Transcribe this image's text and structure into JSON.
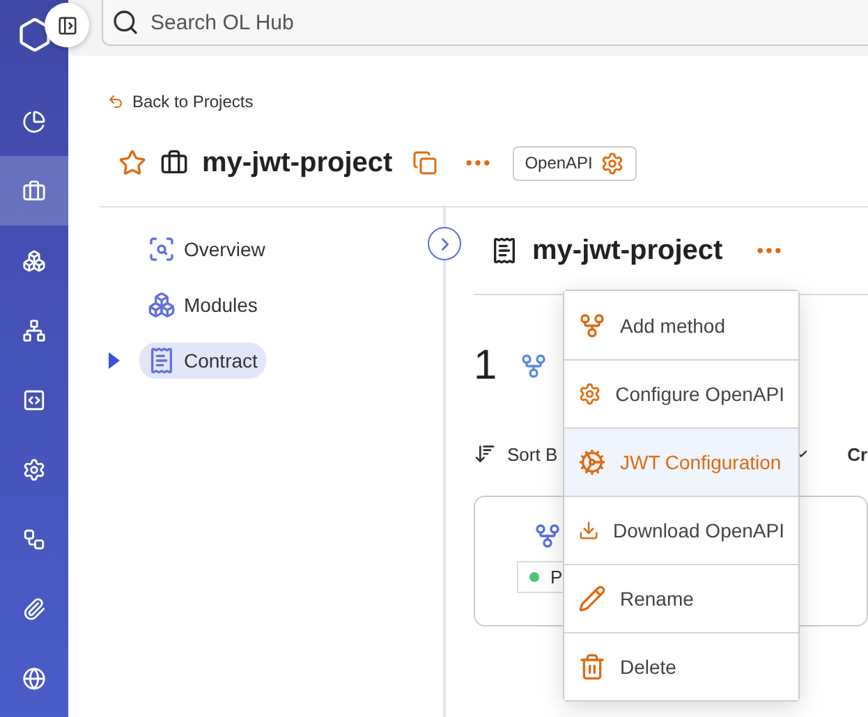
{
  "rail": {
    "items": [
      {
        "selected": false
      },
      {
        "selected": true
      },
      {
        "selected": false
      },
      {
        "selected": false
      },
      {
        "selected": false
      },
      {
        "selected": false
      },
      {
        "selected": false
      },
      {
        "selected": false
      },
      {
        "selected": false
      }
    ]
  },
  "search": {
    "placeholder": "Search OL Hub"
  },
  "back_link": "Back to Projects",
  "project": {
    "title": "my-jwt-project",
    "favorite": false,
    "tag": "OpenAPI"
  },
  "tree": {
    "items": [
      {
        "label": "Overview",
        "selected": false,
        "has_children": false
      },
      {
        "label": "Modules",
        "selected": false,
        "has_children": false
      },
      {
        "label": "Contract",
        "selected": true,
        "has_children": true
      }
    ]
  },
  "contract": {
    "title": "my-jwt-project",
    "count": "1",
    "sort_label": "Sort B",
    "column_label": "Cr",
    "card": {
      "status": "P"
    }
  },
  "menu": {
    "items": [
      {
        "label": "Add method",
        "selected": false
      },
      {
        "label": "Configure OpenAPI",
        "selected": false
      },
      {
        "label": "JWT Configuration",
        "selected": true
      },
      {
        "label": "Download OpenAPI",
        "selected": false
      },
      {
        "label": "Rename",
        "selected": false
      },
      {
        "label": "Delete",
        "selected": false
      }
    ]
  }
}
